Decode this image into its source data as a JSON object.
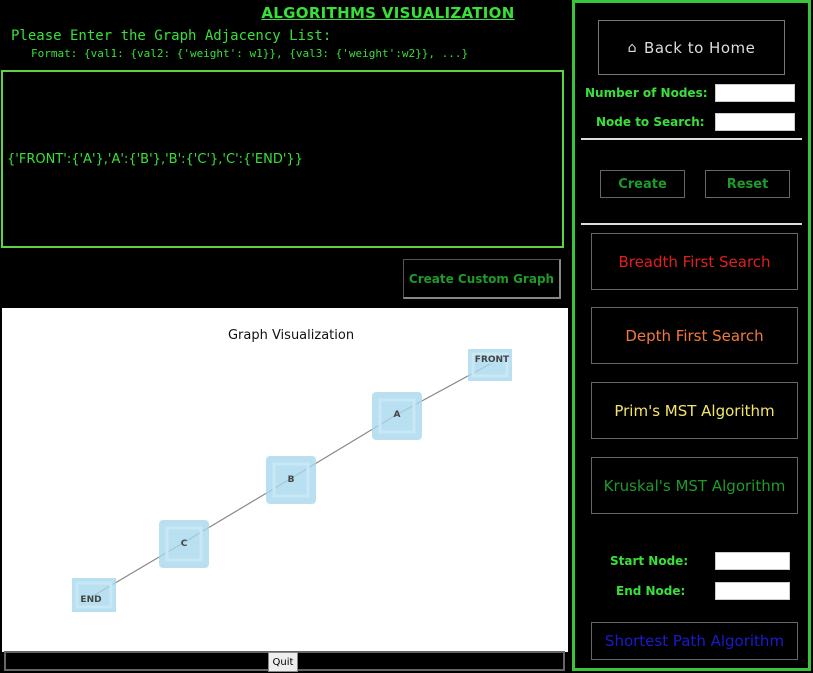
{
  "header": {
    "title": "ALGORITHMS VISUALIZATION",
    "prompt": "Please Enter the Graph Adjacency List:",
    "format": "Format: {val1: {val2: {'weight': w1}}, {val3: {'weight':w2}}, ...}"
  },
  "adjacency_input": {
    "value": "{'FRONT':{'A'},'A':{'B'},'B':{'C'},'C':{'END'}}"
  },
  "create_custom_graph_label": "Create Custom Graph",
  "graph": {
    "title": "Graph Visualization",
    "nodes": [
      {
        "id": "FRONT",
        "label": "FRONT"
      },
      {
        "id": "A",
        "label": "A"
      },
      {
        "id": "B",
        "label": "B"
      },
      {
        "id": "C",
        "label": "C"
      },
      {
        "id": "END",
        "label": "END"
      }
    ],
    "edges": [
      [
        "FRONT",
        "A"
      ],
      [
        "A",
        "B"
      ],
      [
        "B",
        "C"
      ],
      [
        "C",
        "END"
      ]
    ],
    "node_color": "#add8e6"
  },
  "quit_label": "Quit",
  "panel": {
    "home_icon": "⌂",
    "home_label": "Back to Home",
    "num_nodes_label": "Number of Nodes:",
    "num_nodes_value": "",
    "node_search_label": "Node to Search:",
    "node_search_value": "",
    "create_label": "Create",
    "reset_label": "Reset",
    "bfs_label": "Breadth First Search",
    "dfs_label": "Depth First Search",
    "prim_label": "Prim's MST Algorithm",
    "kruskal_label": "Kruskal's MST Algorithm",
    "start_node_label": "Start Node:",
    "start_node_value": "",
    "end_node_label": "End Node:",
    "end_node_value": "",
    "shortest_path_label": "Shortest Path Algorithm"
  },
  "colors": {
    "accent_green": "#39e03a",
    "bfs": "#e0201c",
    "dfs": "#f07a3a",
    "prim": "#f2e66a",
    "kruskal": "#1e9b2a",
    "shortest_path": "#1a1ad0"
  }
}
